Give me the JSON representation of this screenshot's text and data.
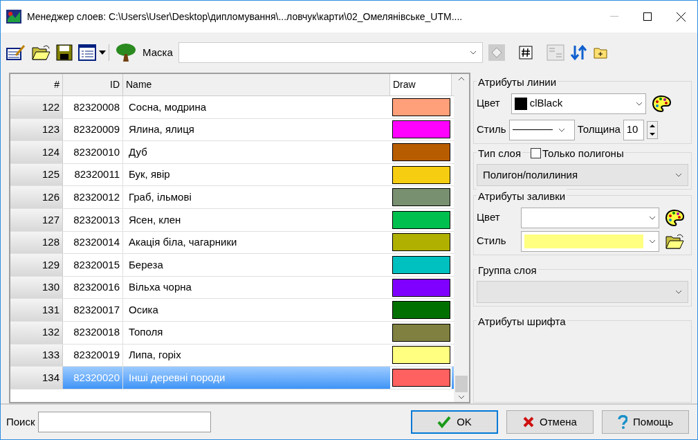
{
  "window": {
    "title": "Менеджер слоев: C:\\Users\\User\\Desktop\\дипломування\\...ловчук\\карти\\02_Омелянівське_UTM...."
  },
  "toolbar": {
    "mask_label": "Маска"
  },
  "table": {
    "columns": [
      "#",
      "ID",
      "Name",
      "Draw"
    ],
    "rows": [
      {
        "num": "122",
        "id": "82320008",
        "name": "Сосна, модрина",
        "color": "#ffa07a",
        "selected": false
      },
      {
        "num": "123",
        "id": "82320009",
        "name": "Ялина, ялиця",
        "color": "#ff00ff",
        "selected": false
      },
      {
        "num": "124",
        "id": "82320010",
        "name": "Дуб",
        "color": "#b85c00",
        "selected": false
      },
      {
        "num": "125",
        "id": "82320011",
        "name": "Бук, явір",
        "color": "#f7cd12",
        "selected": false
      },
      {
        "num": "126",
        "id": "82320012",
        "name": "Граб, ільмові",
        "color": "#789070",
        "selected": false
      },
      {
        "num": "127",
        "id": "82320013",
        "name": "Ясен, клен",
        "color": "#00c050",
        "selected": false
      },
      {
        "num": "128",
        "id": "82320014",
        "name": "Акація біла, чагарники",
        "color": "#b0b000",
        "selected": false
      },
      {
        "num": "129",
        "id": "82320015",
        "name": "Береза",
        "color": "#00c0c0",
        "selected": false
      },
      {
        "num": "130",
        "id": "82320016",
        "name": "Вільха чорна",
        "color": "#8000ff",
        "selected": false
      },
      {
        "num": "131",
        "id": "82320017",
        "name": "Осика",
        "color": "#007000",
        "selected": false
      },
      {
        "num": "132",
        "id": "82320018",
        "name": "Тополя",
        "color": "#808040",
        "selected": false
      },
      {
        "num": "133",
        "id": "82320019",
        "name": "Липа, горіх",
        "color": "#ffff80",
        "selected": false
      },
      {
        "num": "134",
        "id": "82320020",
        "name": "Інші деревні породи",
        "color": "#ff6060",
        "selected": true
      }
    ]
  },
  "line_attributes": {
    "title": "Атрибуты линии",
    "color_label": "Цвет",
    "color_value": "clBlack",
    "color_swatch": {
      "color": "#000000"
    },
    "style_label": "Стиль",
    "thickness_label": "Толщина",
    "thickness_value": "10"
  },
  "layer_type": {
    "title": "Тип слоя",
    "polygons_only_label": "Только полигоны",
    "polygons_only_checked": false,
    "type_value": "Полигон/полилиния"
  },
  "fill_attributes": {
    "title": "Атрибуты заливки",
    "color_label": "Цвет",
    "style_label": "Стиль",
    "style_swatch": {
      "color": "#ffff80"
    }
  },
  "layer_group": {
    "title": "Группа слоя"
  },
  "font_attributes": {
    "title": "Атрибуты шрифта"
  },
  "search": {
    "label": "Поиск"
  },
  "buttons": [
    {
      "kind": "ok",
      "label": "OK",
      "focused": true
    },
    {
      "kind": "cancel",
      "label": "Отмена",
      "focused": false
    },
    {
      "kind": "help",
      "label": "Помощь",
      "focused": false
    }
  ]
}
